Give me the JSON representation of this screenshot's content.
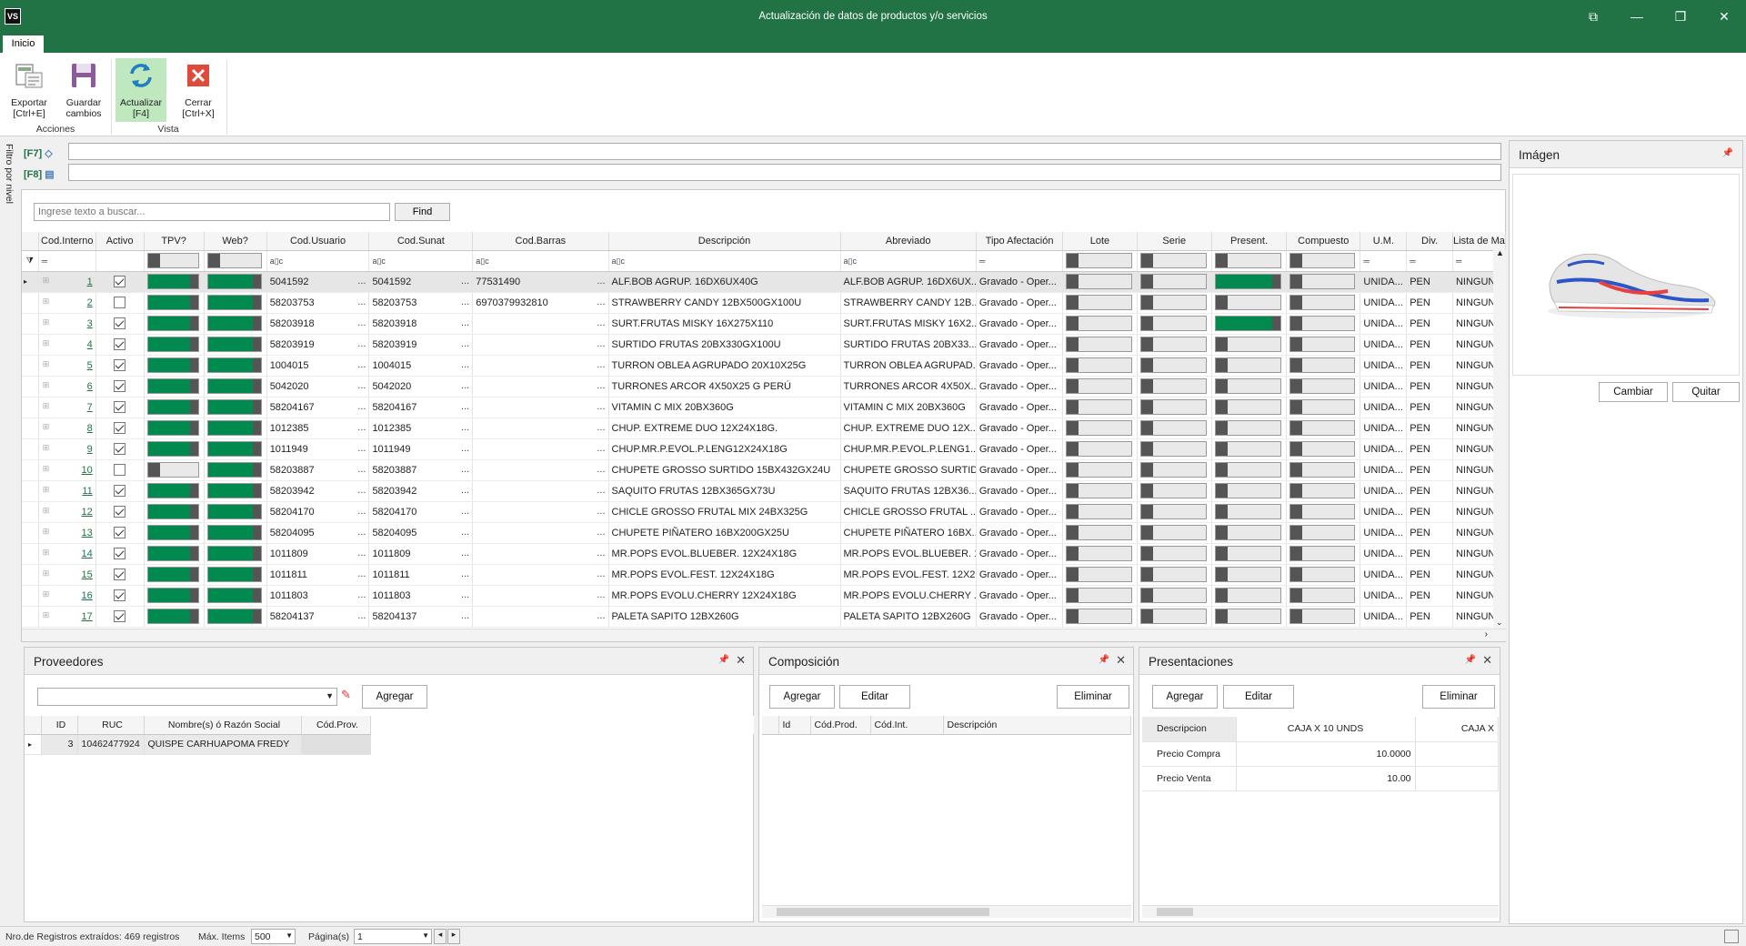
{
  "window": {
    "title": "Actualización de datos de productos y/o servicios",
    "logo": "VS"
  },
  "tabs": [
    "Inicio"
  ],
  "ribbon": {
    "buttons": [
      {
        "label1": "Exportar",
        "label2": "[Ctrl+E]",
        "icon": "export-icon"
      },
      {
        "label1": "Guardar",
        "label2": "cambios",
        "icon": "save-icon"
      },
      {
        "label1": "Actualizar",
        "label2": "[F4]",
        "icon": "refresh-icon"
      },
      {
        "label1": "Cerrar",
        "label2": "[Ctrl+X]",
        "icon": "close-icon"
      }
    ],
    "groups": [
      "Acciones",
      "Vista"
    ]
  },
  "filters": {
    "vertical_label": "Filtro por nivel",
    "f7": "[F7]",
    "f8": "[F8]"
  },
  "search": {
    "placeholder": "Ingrese texto a buscar...",
    "find": "Find"
  },
  "grid": {
    "columns": [
      "Cod.Interno",
      "Activo",
      "TPV?",
      "Web?",
      "Cod.Usuario",
      "Cod.Sunat",
      "Cod.Barras",
      "Descripción",
      "Abreviado",
      "Tipo Afectación",
      "Lote",
      "Serie",
      "Present.",
      "Compuesto",
      "U.M.",
      "Div.",
      "Lista de Mat"
    ],
    "filter_glyph": "a▯c",
    "rows": [
      {
        "id": "1",
        "activo": true,
        "tpv": true,
        "web": true,
        "usr": "5041592",
        "sunat": "5041592",
        "barras": "77531490",
        "desc": "ALF.BOB AGRUP. 16DX6UX40G",
        "abr": "ALF.BOB AGRUP. 16DX6UX...",
        "tipo": "Gravado - Oper...",
        "lote": false,
        "serie": false,
        "pres": true,
        "comp": false,
        "um": "UNIDA...",
        "div": "PEN",
        "lista": "NINGUNO"
      },
      {
        "id": "2",
        "activo": false,
        "tpv": true,
        "web": true,
        "usr": "58203753",
        "sunat": "58203753",
        "barras": "6970379932810",
        "desc": "STRAWBERRY CANDY 12BX500GX100U",
        "abr": "STRAWBERRY CANDY 12B...",
        "tipo": "Gravado - Oper...",
        "lote": false,
        "serie": false,
        "pres": false,
        "comp": false,
        "um": "UNIDA...",
        "div": "PEN",
        "lista": "NINGUNO"
      },
      {
        "id": "3",
        "activo": true,
        "tpv": true,
        "web": true,
        "usr": "58203918",
        "sunat": "58203918",
        "barras": "",
        "desc": "SURT.FRUTAS MISKY 16X275X110",
        "abr": "SURT.FRUTAS MISKY 16X2...",
        "tipo": "Gravado - Oper...",
        "lote": false,
        "serie": false,
        "pres": true,
        "comp": false,
        "um": "UNIDA...",
        "div": "PEN",
        "lista": "NINGUNO"
      },
      {
        "id": "4",
        "activo": true,
        "tpv": true,
        "web": true,
        "usr": "58203919",
        "sunat": "58203919",
        "barras": "",
        "desc": "SURTIDO FRUTAS 20BX330GX100U",
        "abr": "SURTIDO FRUTAS 20BX33...",
        "tipo": "Gravado - Oper...",
        "lote": false,
        "serie": false,
        "pres": false,
        "comp": false,
        "um": "UNIDA...",
        "div": "PEN",
        "lista": "NINGUNO"
      },
      {
        "id": "5",
        "activo": true,
        "tpv": true,
        "web": true,
        "usr": "1004015",
        "sunat": "1004015",
        "barras": "",
        "desc": "TURRON OBLEA AGRUPADO 20X10X25G",
        "abr": "TURRON OBLEA AGRUPAD...",
        "tipo": "Gravado - Oper...",
        "lote": false,
        "serie": false,
        "pres": false,
        "comp": false,
        "um": "UNIDA...",
        "div": "PEN",
        "lista": "NINGUNO"
      },
      {
        "id": "6",
        "activo": true,
        "tpv": true,
        "web": true,
        "usr": "5042020",
        "sunat": "5042020",
        "barras": "",
        "desc": "TURRONES ARCOR 4X50X25 G PERÚ",
        "abr": "TURRONES ARCOR 4X50X...",
        "tipo": "Gravado - Oper...",
        "lote": false,
        "serie": false,
        "pres": false,
        "comp": false,
        "um": "UNIDA...",
        "div": "PEN",
        "lista": "NINGUNO"
      },
      {
        "id": "7",
        "activo": true,
        "tpv": true,
        "web": true,
        "usr": "58204167",
        "sunat": "58204167",
        "barras": "",
        "desc": "VITAMIN C MIX 20BX360G",
        "abr": "VITAMIN C MIX 20BX360G",
        "tipo": "Gravado - Oper...",
        "lote": false,
        "serie": false,
        "pres": false,
        "comp": false,
        "um": "UNIDA...",
        "div": "PEN",
        "lista": "NINGUNO"
      },
      {
        "id": "8",
        "activo": true,
        "tpv": true,
        "web": true,
        "usr": "1012385",
        "sunat": "1012385",
        "barras": "",
        "desc": "CHUP. EXTREME DUO 12X24X18G.",
        "abr": "CHUP. EXTREME DUO 12X...",
        "tipo": "Gravado - Oper...",
        "lote": false,
        "serie": false,
        "pres": false,
        "comp": false,
        "um": "UNIDA...",
        "div": "PEN",
        "lista": "NINGUNO"
      },
      {
        "id": "9",
        "activo": true,
        "tpv": true,
        "web": true,
        "usr": "1011949",
        "sunat": "1011949",
        "barras": "",
        "desc": "CHUP.MR.P.EVOL.P.LENG12X24X18G",
        "abr": "CHUP.MR.P.EVOL.P.LENG1...",
        "tipo": "Gravado - Oper...",
        "lote": false,
        "serie": false,
        "pres": false,
        "comp": false,
        "um": "UNIDA...",
        "div": "PEN",
        "lista": "NINGUNO"
      },
      {
        "id": "10",
        "activo": false,
        "tpv": false,
        "web": true,
        "usr": "58203887",
        "sunat": "58203887",
        "barras": "",
        "desc": "CHUPETE GROSSO SURTIDO 15BX432GX24U",
        "abr": "CHUPETE GROSSO SURTID...",
        "tipo": "Gravado - Oper...",
        "lote": false,
        "serie": false,
        "pres": false,
        "comp": false,
        "um": "UNIDA...",
        "div": "PEN",
        "lista": "NINGUNO"
      },
      {
        "id": "11",
        "activo": true,
        "tpv": true,
        "web": true,
        "usr": "58203942",
        "sunat": "58203942",
        "barras": "",
        "desc": "SAQUITO FRUTAS 12BX365GX73U",
        "abr": "SAQUITO FRUTAS 12BX36...",
        "tipo": "Gravado - Oper...",
        "lote": false,
        "serie": false,
        "pres": false,
        "comp": false,
        "um": "UNIDA...",
        "div": "PEN",
        "lista": "NINGUNO"
      },
      {
        "id": "12",
        "activo": true,
        "tpv": true,
        "web": true,
        "usr": "58204170",
        "sunat": "58204170",
        "barras": "",
        "desc": "CHICLE GROSSO FRUTAL MIX 24BX325G",
        "abr": "CHICLE GROSSO FRUTAL ...",
        "tipo": "Gravado - Oper...",
        "lote": false,
        "serie": false,
        "pres": false,
        "comp": false,
        "um": "UNIDA...",
        "div": "PEN",
        "lista": "NINGUNO"
      },
      {
        "id": "13",
        "activo": true,
        "tpv": true,
        "web": true,
        "usr": "58204095",
        "sunat": "58204095",
        "barras": "",
        "desc": "CHUPETE PIÑATERO 16BX200GX25U",
        "abr": "CHUPETE PIÑATERO 16BX...",
        "tipo": "Gravado - Oper...",
        "lote": false,
        "serie": false,
        "pres": false,
        "comp": false,
        "um": "UNIDA...",
        "div": "PEN",
        "lista": "NINGUNO"
      },
      {
        "id": "14",
        "activo": true,
        "tpv": true,
        "web": true,
        "usr": "1011809",
        "sunat": "1011809",
        "barras": "",
        "desc": "MR.POPS EVOL.BLUEBER. 12X24X18G",
        "abr": "MR.POPS EVOL.BLUEBER. 1...",
        "tipo": "Gravado - Oper...",
        "lote": false,
        "serie": false,
        "pres": false,
        "comp": false,
        "um": "UNIDA...",
        "div": "PEN",
        "lista": "NINGUNO"
      },
      {
        "id": "15",
        "activo": true,
        "tpv": true,
        "web": true,
        "usr": "1011811",
        "sunat": "1011811",
        "barras": "",
        "desc": "MR.POPS EVOL.FEST. 12X24X18G",
        "abr": "MR.POPS EVOL.FEST. 12X2...",
        "tipo": "Gravado - Oper...",
        "lote": false,
        "serie": false,
        "pres": false,
        "comp": false,
        "um": "UNIDA...",
        "div": "PEN",
        "lista": "NINGUNO"
      },
      {
        "id": "16",
        "activo": true,
        "tpv": true,
        "web": true,
        "usr": "1011803",
        "sunat": "1011803",
        "barras": "",
        "desc": "MR.POPS EVOLU.CHERRY 12X24X18G",
        "abr": "MR.POPS EVOLU.CHERRY ...",
        "tipo": "Gravado - Oper...",
        "lote": false,
        "serie": false,
        "pres": false,
        "comp": false,
        "um": "UNIDA...",
        "div": "PEN",
        "lista": "NINGUNO"
      },
      {
        "id": "17",
        "activo": true,
        "tpv": true,
        "web": true,
        "usr": "58204137",
        "sunat": "58204137",
        "barras": "",
        "desc": "PALETA SAPITO 12BX260G",
        "abr": "PALETA SAPITO 12BX260G",
        "tipo": "Gravado - Oper...",
        "lote": false,
        "serie": false,
        "pres": false,
        "comp": false,
        "um": "UNIDA...",
        "div": "PEN",
        "lista": "NINGUNO"
      }
    ]
  },
  "proveedores": {
    "title": "Proveedores",
    "add": "Agregar",
    "columns": [
      "ID",
      "RUC",
      "Nombre(s) ó Razón Social",
      "Cód.Prov."
    ],
    "rows": [
      {
        "id": "3",
        "ruc": "10462477924",
        "nombre": "QUISPE CARHUAPOMA FREDY",
        "cod": ""
      }
    ]
  },
  "composicion": {
    "title": "Composición",
    "add": "Agregar",
    "edit": "Editar",
    "delete": "Eliminar",
    "columns": [
      "Id",
      "Cód.Prod.",
      "Cód.Int.",
      "Descripción"
    ]
  },
  "presentaciones": {
    "title": "Presentaciones",
    "add": "Agregar",
    "edit": "Editar",
    "delete": "Eliminar",
    "rows": [
      {
        "label": "Descripcion",
        "v1": "CAJA X 10 UNDS",
        "v2": "CAJA X"
      },
      {
        "label": "Precio Compra",
        "v1": "10.0000",
        "v2": ""
      },
      {
        "label": "Precio Venta",
        "v1": "10.00",
        "v2": ""
      }
    ]
  },
  "imagen": {
    "title": "Imágen",
    "change": "Cambiar",
    "remove": "Quitar"
  },
  "status": {
    "records": "Nro.de Registros extraídos: 469 registros",
    "max_label": "Máx. Items",
    "max_value": "500",
    "page_label": "Página(s)",
    "page_value": "1"
  },
  "colors": {
    "green": "#217346",
    "toggle_on": "#008a50"
  }
}
